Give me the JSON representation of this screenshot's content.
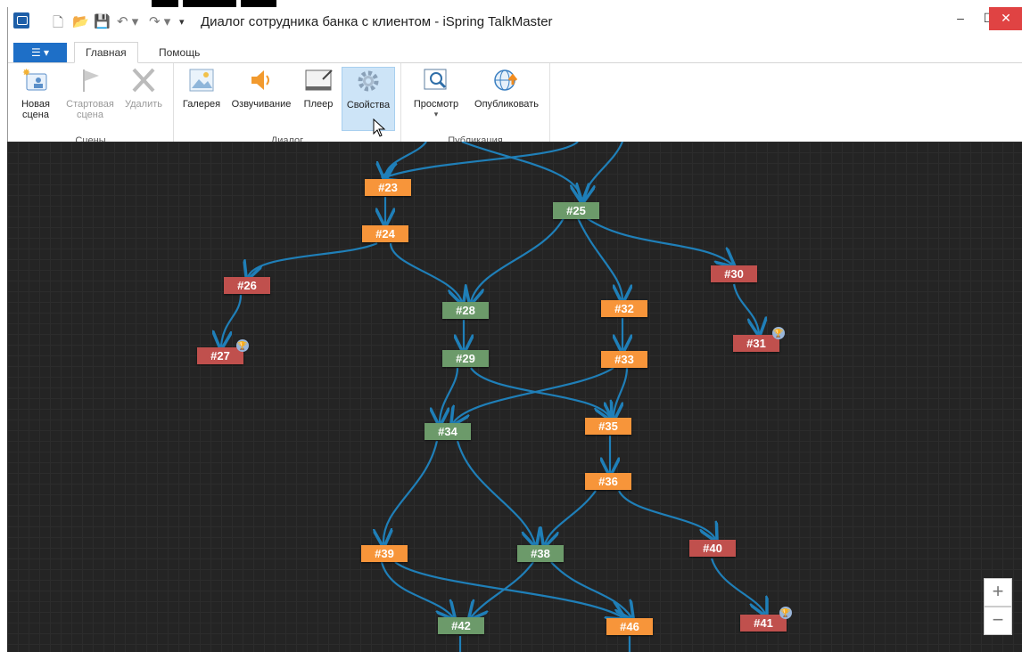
{
  "window": {
    "title": "Диалог сотрудника банка с клиентом - iSpring TalkMaster",
    "controls": {
      "minimize": "–",
      "maximize": "☐",
      "close": "✕"
    }
  },
  "quick_access": [
    "new-icon",
    "open-icon",
    "save-icon",
    "undo-icon",
    "redo-icon",
    "customize-icon"
  ],
  "tabs": {
    "file": "☰ ▾",
    "items": [
      {
        "label": "Главная"
      },
      {
        "label": "Помощь"
      }
    ]
  },
  "ribbon": {
    "groups": [
      {
        "label": "Сцены",
        "buttons": [
          "Новая сцена",
          "Стартовая сцена",
          "Удалить"
        ]
      },
      {
        "label": "Диалог",
        "buttons": [
          "Галерея",
          "Озвучивание",
          "Плеер",
          "Свойства"
        ]
      },
      {
        "label": "Публикация",
        "buttons": [
          "Просмотр",
          "Опубликовать"
        ]
      }
    ],
    "btn": {
      "new_scene_1": "Новая",
      "new_scene_2": "сцена",
      "start_scene_1": "Стартовая",
      "start_scene_2": "сцена",
      "delete": "Удалить",
      "gallery": "Галерея",
      "voice": "Озвучивание",
      "player": "Плеер",
      "props": "Свойства",
      "preview": "Просмотр",
      "preview_caret": "▾",
      "publish": "Опубликовать"
    }
  },
  "graph": {
    "nodes": [
      {
        "id": "#23",
        "color": "orange"
      },
      {
        "id": "#25",
        "color": "green"
      },
      {
        "id": "#24",
        "color": "orange"
      },
      {
        "id": "#26",
        "color": "red"
      },
      {
        "id": "#30",
        "color": "red"
      },
      {
        "id": "#28",
        "color": "green"
      },
      {
        "id": "#32",
        "color": "orange"
      },
      {
        "id": "#27",
        "color": "red",
        "final": true
      },
      {
        "id": "#31",
        "color": "red",
        "final": true
      },
      {
        "id": "#29",
        "color": "green"
      },
      {
        "id": "#33",
        "color": "orange"
      },
      {
        "id": "#34",
        "color": "green"
      },
      {
        "id": "#35",
        "color": "orange"
      },
      {
        "id": "#36",
        "color": "orange"
      },
      {
        "id": "#39",
        "color": "orange"
      },
      {
        "id": "#38",
        "color": "green"
      },
      {
        "id": "#40",
        "color": "red"
      },
      {
        "id": "#42",
        "color": "green"
      },
      {
        "id": "#46",
        "color": "orange"
      },
      {
        "id": "#41",
        "color": "red",
        "final": true
      }
    ],
    "colors": {
      "orange": "#f7953a",
      "green": "#6c9a6a",
      "red": "#c0504d",
      "edge": "#1f7fb8"
    }
  },
  "zoom": {
    "in": "+",
    "out": "−"
  }
}
